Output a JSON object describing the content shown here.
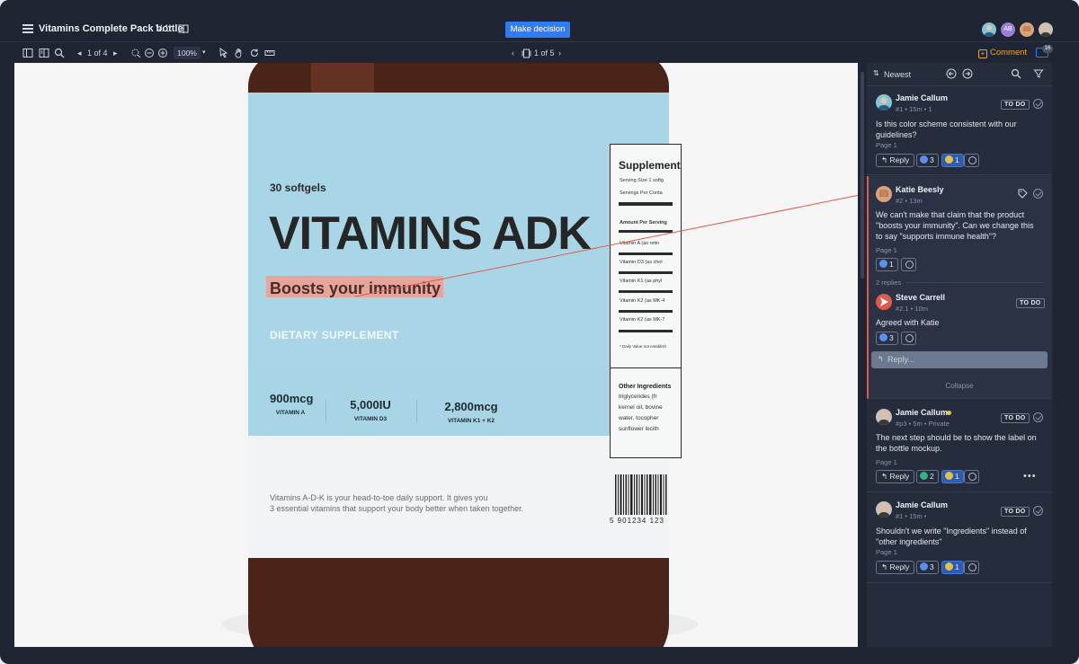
{
  "header": {
    "title": "Vitamins Complete Pack bottle",
    "version": "V.1",
    "decision_button": "Make decision",
    "avatar_initials": "AB"
  },
  "toolbar": {
    "page_indicator": "1 of 4",
    "zoom": "100%",
    "page_set": "1 of 5",
    "comment_button": "Comment",
    "comment_count": "16"
  },
  "canvas": {
    "softgels": "30 softgels",
    "brand": "VITAMINS ADK",
    "tagline": "Boosts your immunity",
    "dietary": "DIETARY SUPPLEMENT",
    "stats": [
      {
        "value": "900mcg",
        "label": "VITAMIN A"
      },
      {
        "value": "5,000IU",
        "label": "VITAMIN D3"
      },
      {
        "value": "2,800mcg",
        "label": "VITAMIN K1 + K2"
      }
    ],
    "blurb_line1": "Vitamins A-D-K is your head-to-toe daily support. It gives you",
    "blurb_line2": "3 essential vitamins that support your body better when taken together.",
    "supplement_title": "Supplement",
    "supp_lines": [
      "Serving Size 1 softg",
      "Servings Per Conta",
      "Amount Per Serving",
      "Vitamin A (as retin",
      "Vitamin D3 (as chol",
      "Vitamin K1 (as phyl",
      "Vitamin K2 (as MK-4",
      "Vitamin K2 (as MK-7",
      "* Daily Value not establish"
    ],
    "ingredients_title": "Other Ingredients",
    "ingredients_lines": [
      "triglycerides (fr",
      "kernel oil, bovine",
      "water, tocopher",
      "sunflower lecith"
    ],
    "barcode_number": "5 901234 123"
  },
  "panel": {
    "sort_label": "Newest",
    "comments": [
      {
        "author": "Jamie Callum",
        "meta": "#1 • 15m • 1",
        "status": "TO DO",
        "body": "Is this color scheme consistent with our guidelines?",
        "page": "Page 1",
        "reply": "Reply",
        "reactions": [
          "3",
          "1"
        ]
      },
      {
        "author": "Katie Beesly",
        "meta": "#2 • 13m",
        "body": "We can't make that claim that the product \"boosts your immunity\". Can we change this to say \"supports immune health\"?",
        "page": "Page 1",
        "reactions": [
          "1"
        ],
        "replies_label": "2 replies",
        "sub_author": "Steve Carrell",
        "sub_meta": "#2.1 • 10m",
        "sub_status": "TO DO",
        "sub_body": "Agreed with Katie",
        "sub_reactions": [
          "3"
        ],
        "reply_placeholder": "Reply...",
        "collapse": "Collapse"
      },
      {
        "author": "Jamie Callum",
        "meta": "#p3 • 5m • Private",
        "status": "TO DO",
        "body": "The next step should be to show the label on the bottle mockup.",
        "page": "Page 1",
        "reply": "Reply",
        "reactions": [
          "2",
          "1"
        ]
      },
      {
        "author": "Jamie Callum",
        "meta": "#1 • 15m • ",
        "status": "TO DO",
        "body": "Shouldn't we write \"Ingredients\" instead of \"other ingredients\"",
        "page": "Page 1",
        "reply": "Reply",
        "reactions": [
          "3",
          "1"
        ]
      }
    ]
  },
  "colors": {
    "accent": "#2f7cf6",
    "highlight": "#e6a59b",
    "label_blue": "#a8d6e6",
    "comment_orange": "#e5a83a",
    "active_marker": "#e05a4c"
  }
}
